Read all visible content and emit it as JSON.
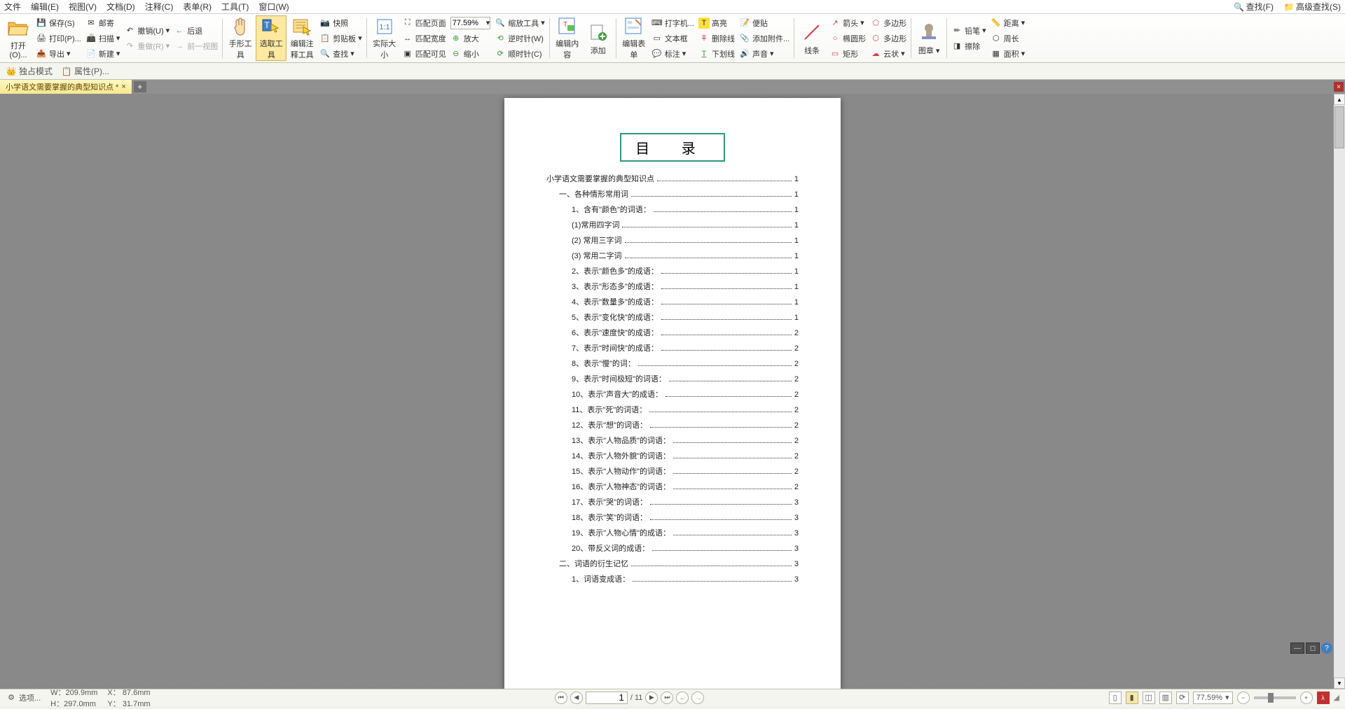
{
  "menu": {
    "file": "文件",
    "edit": "编辑(E)",
    "view": "视图(V)",
    "document": "文档(D)",
    "comments": "注释(C)",
    "forms": "表单(R)",
    "tools": "工具(T)",
    "window": "窗口(W)",
    "find": "查找(F)",
    "advfind": "高级查找(S)"
  },
  "ribbon": {
    "open": "打开(O)...",
    "save": "保存(S)",
    "mail": "邮寄",
    "undo": "撤销(U)",
    "back": "后退",
    "print": "打印(P)...",
    "scan": "扫描",
    "redo": "重做(R)",
    "forward": "前一视图",
    "export": "导出",
    "new": "新建",
    "hand": "手形工具",
    "select": "选取工具",
    "editcomment": "编辑注释工具",
    "snapshot": "快照",
    "clipboard": "剪贴板",
    "findbtn": "查找",
    "actual": "实际大小",
    "fit11": "1:1",
    "fitpage": "匹配页面",
    "fitwidth": "匹配宽度",
    "fitvisible": "匹配可见",
    "zoom": "77.59%",
    "zoomtool": "缩放工具",
    "zoomin": "放大",
    "zoomout": "缩小",
    "ccw": "逆时针(W)",
    "cw": "顺时针(C)",
    "editcontent": "编辑内容",
    "add": "添加",
    "editform": "编辑表单",
    "typewriter": "打字机...",
    "textbox": "文本框",
    "callout": "标注",
    "highlight": "高亮",
    "strikeout": "删除线",
    "underline": "下划线",
    "note": "便贴",
    "attach": "添加附件...",
    "sound": "声音",
    "line": "线条",
    "arrow": "箭头",
    "ellipse": "椭圆形",
    "rect": "矩形",
    "polygon": "多边形",
    "polygon2": "多边形",
    "cloud": "云状",
    "stamp": "图章",
    "pencil": "铅笔",
    "eraser": "擦除",
    "distance": "距离",
    "perimeter": "周长",
    "area": "面积"
  },
  "secondbar": {
    "exclusive": "独占模式",
    "properties": "属性(P)..."
  },
  "tab": {
    "title": "小学语文需要掌握的典型知识点 *"
  },
  "doc": {
    "title": "目    录",
    "toc": [
      {
        "indent": 0,
        "label": "小学语文需要掌握的典型知识点",
        "page": "1"
      },
      {
        "indent": 1,
        "label": "一、各种情形常用词",
        "page": "1"
      },
      {
        "indent": 2,
        "label": "1、含有\"颜色\"的词语：",
        "page": "1"
      },
      {
        "indent": 3,
        "label": "(1)常用四字词",
        "page": "1"
      },
      {
        "indent": 3,
        "label": "(2) 常用三字词",
        "page": "1"
      },
      {
        "indent": 3,
        "label": "(3) 常用二字词",
        "page": "1"
      },
      {
        "indent": 2,
        "label": "2、表示\"颜色多\"的成语：",
        "page": "1"
      },
      {
        "indent": 2,
        "label": "3、表示\"形态多\"的成语：",
        "page": "1"
      },
      {
        "indent": 2,
        "label": "4、表示\"数量多\"的成语：",
        "page": "1"
      },
      {
        "indent": 2,
        "label": "5、表示\"变化快\"的成语：",
        "page": "1"
      },
      {
        "indent": 2,
        "label": "6、表示\"速度快\"的成语：",
        "page": "2"
      },
      {
        "indent": 2,
        "label": "7、表示\"时间快\"的成语：",
        "page": "2"
      },
      {
        "indent": 2,
        "label": "8、表示\"慢\"的词：",
        "page": "2"
      },
      {
        "indent": 2,
        "label": "9、表示\"时间极短\"的词语：",
        "page": "2"
      },
      {
        "indent": 2,
        "label": "10、表示\"声音大\"的成语：",
        "page": "2"
      },
      {
        "indent": 2,
        "label": "11、表示\"死\"的词语：",
        "page": "2"
      },
      {
        "indent": 2,
        "label": "12、表示\"想\"的词语：",
        "page": "2"
      },
      {
        "indent": 2,
        "label": "13、表示\"人物品质\"的词语：",
        "page": "2"
      },
      {
        "indent": 2,
        "label": "14、表示\"人物外貌\"的词语：",
        "page": "2"
      },
      {
        "indent": 2,
        "label": "15、表示\"人物动作\"的词语：",
        "page": "2"
      },
      {
        "indent": 2,
        "label": "16、表示\"人物神态\"的词语：",
        "page": "2"
      },
      {
        "indent": 2,
        "label": "17、表示\"哭\"的词语：",
        "page": "3"
      },
      {
        "indent": 2,
        "label": "18、表示\"笑\"的词语：",
        "page": "3"
      },
      {
        "indent": 2,
        "label": "19、表示\"人物心情\"的成语：",
        "page": "3"
      },
      {
        "indent": 2,
        "label": "20、带反义词的成语：",
        "page": "3"
      },
      {
        "indent": 1,
        "label": "二、词语的衍生记忆",
        "page": "3"
      },
      {
        "indent": 2,
        "label": "1、词语变成语：",
        "page": "3"
      }
    ]
  },
  "status": {
    "options": "选项...",
    "w": "W：209.9mm",
    "h": "H：297.0mm",
    "x": "X： 87.6mm",
    "y": "Y： 31.7mm",
    "page_cur": "1",
    "page_total": "11",
    "zoom": "77.59%"
  }
}
